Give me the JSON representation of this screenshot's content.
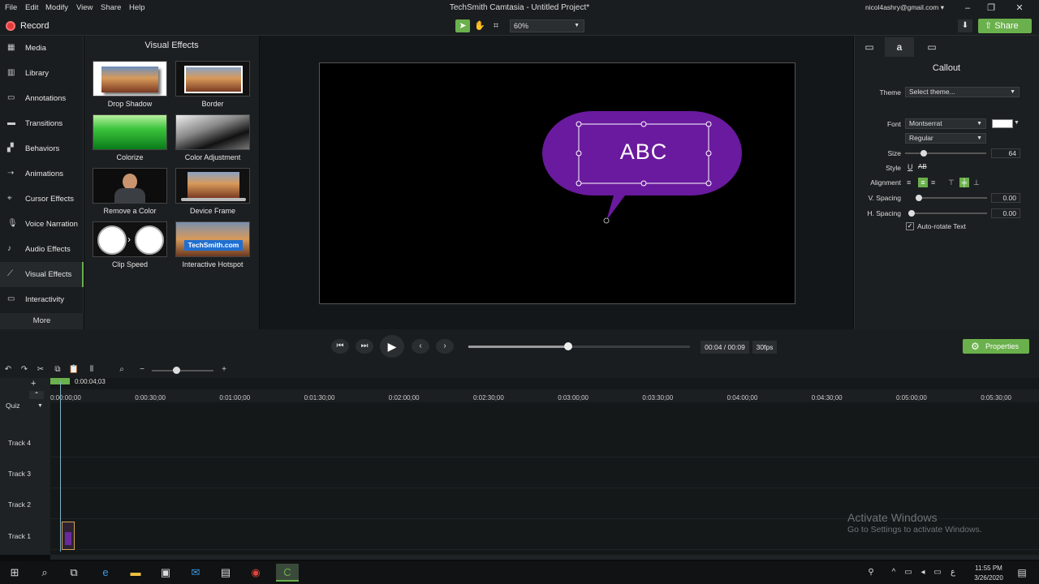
{
  "menu": {
    "file": "File",
    "edit": "Edit",
    "modify": "Modify",
    "view": "View",
    "share": "Share",
    "help": "Help"
  },
  "window": {
    "title": "TechSmith Camtasia - Untitled Project*",
    "account": "nicol4ashry@gmail.com ▾"
  },
  "toolbar": {
    "record_label": "Record",
    "zoom": "60%",
    "share_label": "Share"
  },
  "sidebar": {
    "items": [
      {
        "label": "Media"
      },
      {
        "label": "Library"
      },
      {
        "label": "Annotations"
      },
      {
        "label": "Transitions"
      },
      {
        "label": "Behaviors"
      },
      {
        "label": "Animations"
      },
      {
        "label": "Cursor Effects"
      },
      {
        "label": "Voice Narration"
      },
      {
        "label": "Audio Effects"
      },
      {
        "label": "Visual Effects"
      },
      {
        "label": "Interactivity"
      }
    ],
    "more": "More"
  },
  "effects_panel": {
    "title": "Visual Effects",
    "effects": [
      {
        "label": "Drop Shadow"
      },
      {
        "label": "Border"
      },
      {
        "label": "Colorize"
      },
      {
        "label": "Color Adjustment"
      },
      {
        "label": "Remove a Color"
      },
      {
        "label": "Device Frame"
      },
      {
        "label": "Clip Speed"
      },
      {
        "label": "Interactive Hotspot"
      }
    ],
    "hotspot_badge": "TechSmith.com"
  },
  "canvas": {
    "callout_text": "ABC"
  },
  "properties": {
    "title": "Callout",
    "theme_label": "Theme",
    "theme_value": "Select theme...",
    "font_label": "Font",
    "font_value": "Montserrat",
    "weight_value": "Regular",
    "size_label": "Size",
    "size_value": "64",
    "style_label": "Style",
    "style_underline": "U",
    "style_strike": "AB",
    "alignment_label": "Alignment",
    "vspacing_label": "V. Spacing",
    "vspacing_value": "0.00",
    "hspacing_label": "H. Spacing",
    "hspacing_value": "0.00",
    "autorotate_label": "Auto-rotate Text",
    "autorotate_checked": true
  },
  "playback": {
    "timecode": "00:04 / 00:09",
    "fps": "30fps",
    "properties_label": "Properties",
    "progress": 0.45
  },
  "timeline": {
    "playhead_time": "0:00:04;03",
    "ticks": [
      "0:00:00;00",
      "0:00:30;00",
      "0:01:00;00",
      "0:01:30;00",
      "0:02:00;00",
      "0:02:30;00",
      "0:03:00;00",
      "0:03:30;00",
      "0:04:00;00",
      "0:04:30;00",
      "0:05:00;00",
      "0:05:30;00"
    ],
    "quiz_label": "Quiz",
    "tracks": [
      {
        "label": "Track 4"
      },
      {
        "label": "Track 3"
      },
      {
        "label": "Track 2"
      },
      {
        "label": "Track 1"
      }
    ]
  },
  "watermark": {
    "line1": "Activate Windows",
    "line2": "Go to Settings to activate Windows."
  },
  "taskbar": {
    "time": "11:55 PM",
    "date": "3/26/2020"
  },
  "colors": {
    "accent": "#6ab04c",
    "callout": "#6a1a9e",
    "record": "#e23b3b"
  }
}
